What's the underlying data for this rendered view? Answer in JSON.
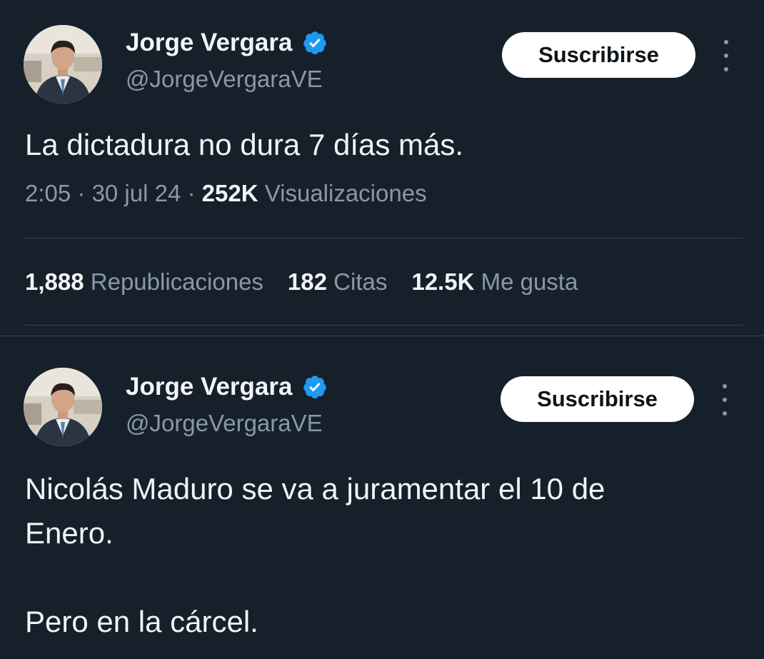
{
  "tweets": [
    {
      "author": {
        "name": "Jorge Vergara",
        "handle": "@JorgeVergaraVE"
      },
      "subscribe_label": "Suscribirse",
      "text_lines": [
        "La dictadura no dura 7 días más."
      ],
      "meta": {
        "time": "2:05",
        "sep1": " · ",
        "date": "30 jul 24",
        "sep2": " · ",
        "views_count": "252K",
        "views_label": " Visualizaciones"
      },
      "stats": {
        "reposts_count": "1,888",
        "reposts_label": "Republicaciones",
        "quotes_count": "182",
        "quotes_label": "Citas",
        "likes_count": "12.5K",
        "likes_label": "Me gusta"
      }
    },
    {
      "author": {
        "name": "Jorge Vergara",
        "handle": "@JorgeVergaraVE"
      },
      "subscribe_label": "Suscribirse",
      "text_lines": [
        "Nicolás Maduro se va a juramentar el 10 de",
        "Enero.",
        "",
        "Pero en la cárcel."
      ]
    }
  ],
  "colors": {
    "background": "#15202b",
    "verified_badge": "#1d9bf0",
    "text_primary": "#f2f4f5",
    "text_secondary": "#8b98a5",
    "divider": "#38444d"
  },
  "icons": [
    "verified-badge-icon",
    "more-options-icon"
  ]
}
